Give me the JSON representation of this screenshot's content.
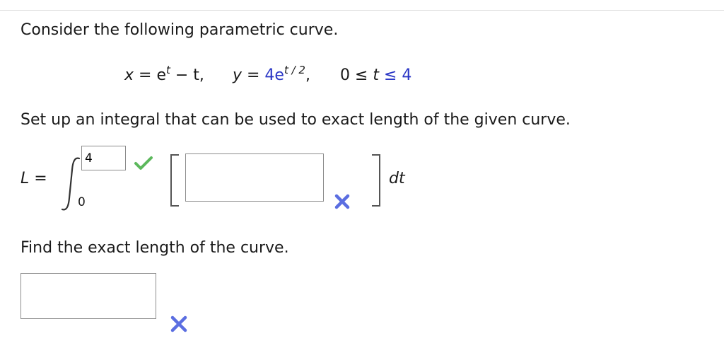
{
  "question": {
    "intro": "Consider the following parametric curve.",
    "equation": {
      "x_lhs": "x",
      "x_eq": " = e",
      "x_exp": "t",
      "x_rest": " − t,",
      "y_lhs": "y",
      "y_eq": " = ",
      "y_coef": "4e",
      "y_exp": "t / 2",
      "y_comma": ",",
      "range_left": "0 ≤ ",
      "range_var": "t",
      "range_right": " ≤ 4"
    },
    "prompt": "Set up an integral that can be used to exact length of the given curve.",
    "integral": {
      "lhs": "L",
      "equals": "=",
      "upper_limit_value": "4",
      "lower_limit": "0",
      "integrand_value": "",
      "differential": "dt"
    },
    "find_prompt": "Find the exact length of the curve.",
    "length_value": ""
  },
  "status": {
    "upper_limit": "correct",
    "integrand": "incorrect",
    "length": "incorrect"
  },
  "colors": {
    "correct": "#5cb85c",
    "incorrect": "#5b6ee1",
    "range_text": "#2b37c6"
  }
}
